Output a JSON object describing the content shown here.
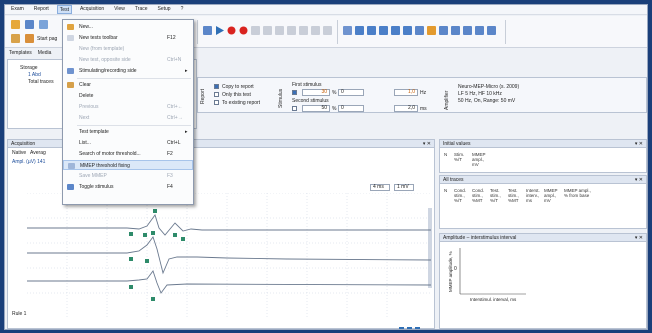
{
  "menubar": [
    "Exam",
    "Report",
    "Test",
    "Acquisition",
    "View",
    "Trace",
    "Setup",
    "?"
  ],
  "toolbar": {
    "start_label": "Start pag"
  },
  "tabstrip": [
    "Templates",
    "Media"
  ],
  "template_panel": {
    "storage_label": "Storage",
    "item1": "1 Abd",
    "item2": "Total traces"
  },
  "report_group": {
    "label": "Report",
    "copy": "Copy to report",
    "only_test": "Only this test",
    "existing": "To existing report"
  },
  "stimulus_group": {
    "label": "Stimulus",
    "first": "First stimulus",
    "second": "Second stimulus",
    "first_val": "30",
    "first_unit": "%",
    "first_val2": "0",
    "freq_val": "1,0",
    "freq_unit": "Hz",
    "second_val": "50",
    "second_unit": "%",
    "second_val2": "0",
    "second_freq": "2,0",
    "ms": "ms"
  },
  "amplifier": {
    "label": "Amplifier",
    "line1": "Neuro-MEP-Micro (s. 2009)",
    "line2": "LF 5 Hz, HF 10 kHz",
    "line3": "50 Hz, On, Range: 50 mV"
  },
  "test_menu": {
    "items": [
      {
        "label": "New...",
        "key": "",
        "disabled": false
      },
      {
        "label": "New tests toolbar",
        "key": "F12",
        "disabled": false
      },
      {
        "label": "New (from template)",
        "key": "",
        "disabled": true
      },
      {
        "label": "New test, opposite side",
        "key": "Ctrl+N",
        "disabled": true
      },
      {
        "label": "Stimulating/recording side",
        "key": "",
        "disabled": false
      },
      {
        "label": "Clear",
        "key": "",
        "disabled": false
      },
      {
        "label": "Delete",
        "key": "",
        "disabled": false
      },
      {
        "label": "Previous",
        "key": "Ctrl+←",
        "disabled": true
      },
      {
        "label": "Next",
        "key": "Ctrl+→",
        "disabled": true
      },
      {
        "label": "Test template",
        "key": "",
        "disabled": false
      },
      {
        "label": "List...",
        "key": "Ctrl+L",
        "disabled": false
      },
      {
        "label": "Search of motor threshold...",
        "key": "F2",
        "disabled": false
      },
      {
        "label": "MMEP threshold fixing",
        "key": "",
        "disabled": false
      },
      {
        "label": "Save MMEP",
        "key": "F3",
        "disabled": true
      },
      {
        "label": "Toggle stimulus",
        "key": "F4",
        "disabled": false
      }
    ]
  },
  "acquisition": {
    "title": "Acquisition",
    "tabs": [
      "Native",
      "Averag"
    ],
    "ampl_label": "Ampl. (µV) 141",
    "sweep": "4 ms",
    "sens": "1 mV",
    "footer": "Rule 1"
  },
  "initial_values": {
    "title": "Initial values",
    "headers": [
      "N",
      "Stim. %/T",
      "MMEP ampl., mV"
    ]
  },
  "all_traces": {
    "title": "All traces",
    "headers": [
      "N",
      "Cond. stim., %/T",
      "Cond. stim., %MT",
      "Test. stim., %/T",
      "Test. stim., %MT",
      "Interst. interv., ms",
      "MMEP ampl., mV",
      "MMEP ampl., % from base"
    ]
  },
  "amplitude_chart": {
    "title": "Amplitude – interstimulus interval",
    "ylabel": "MMEP amplitude, %",
    "xlabel": "Interstimul. interval, ms",
    "y0": "0"
  }
}
